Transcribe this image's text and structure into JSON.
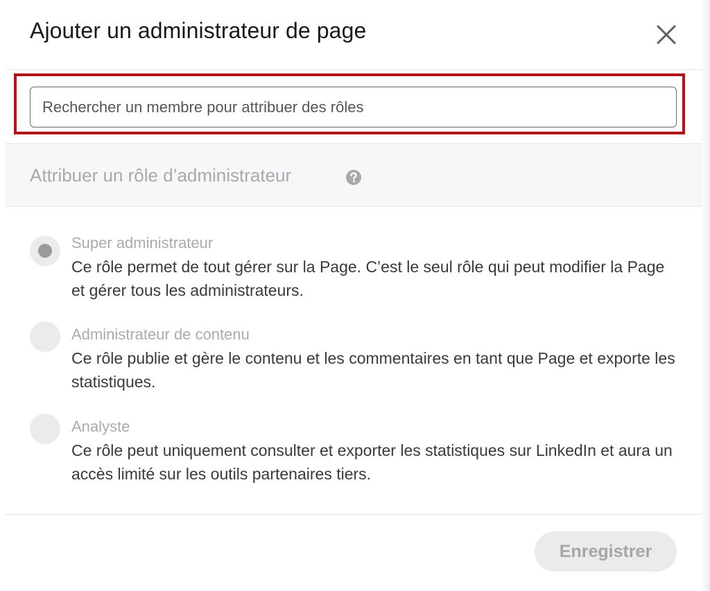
{
  "dialog": {
    "title": "Ajouter un administrateur de page",
    "close_icon": "close-icon"
  },
  "search": {
    "placeholder": "Rechercher un membre pour attribuer des rôles",
    "value": ""
  },
  "roles": {
    "section_title": "Attribuer un rôle d’administrateur",
    "help_icon": "question-circle-icon",
    "items": [
      {
        "name": "Super administrateur",
        "description": "Ce rôle permet de tout gérer sur la Page. C’est le seul rôle qui peut modifier la Page et gérer tous les administrateurs.",
        "selected": true
      },
      {
        "name": "Administrateur de contenu",
        "description": "Ce rôle publie et gère le contenu et les commentaires en tant que Page et exporte les statistiques.",
        "selected": false
      },
      {
        "name": "Analyste",
        "description": "Ce rôle peut uniquement consulter et exporter les statistiques sur LinkedIn et aura un accès limité sur les outils partenaires tiers.",
        "selected": false
      }
    ]
  },
  "footer": {
    "save_label": "Enregistrer"
  },
  "colors": {
    "highlight_border": "#b3141a",
    "disabled_text": "#a9abad",
    "section_background": "#f5f7f9"
  }
}
